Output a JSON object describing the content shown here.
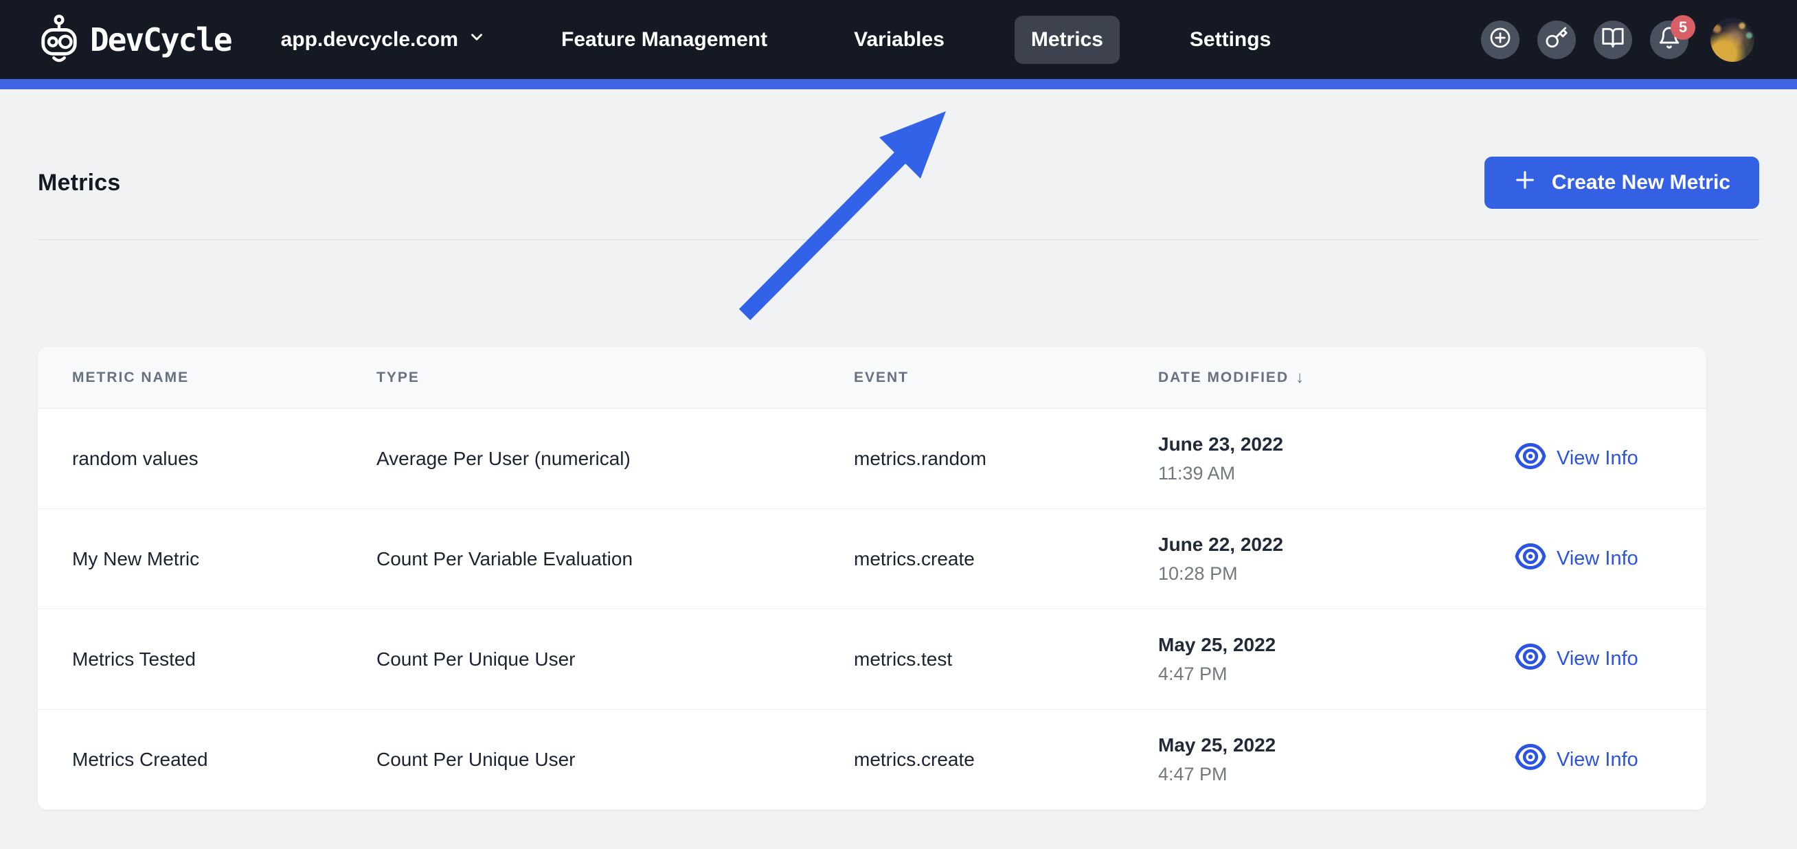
{
  "navbar": {
    "brand": "DevCycle",
    "org_label": "app.devcycle.com",
    "links": [
      {
        "label": "Feature Management",
        "active": false
      },
      {
        "label": "Variables",
        "active": false
      },
      {
        "label": "Metrics",
        "active": true
      },
      {
        "label": "Settings",
        "active": false
      }
    ],
    "notification_count": "5"
  },
  "page": {
    "title": "Metrics",
    "create_button_label": "Create New Metric"
  },
  "table": {
    "columns": [
      "Metric Name",
      "Type",
      "Event",
      "Date Modified"
    ],
    "sort_column": "Date Modified",
    "sort_glyph": "↓",
    "action_label": "View Info",
    "rows": [
      {
        "name": "random values",
        "type": "Average Per User (numerical)",
        "event": "metrics.random",
        "date": "June 23, 2022",
        "time": "11:39 AM"
      },
      {
        "name": "My New Metric",
        "type": "Count Per Variable Evaluation",
        "event": "metrics.create",
        "date": "June 22, 2022",
        "time": "10:28 PM"
      },
      {
        "name": "Metrics Tested",
        "type": "Count Per Unique User",
        "event": "metrics.test",
        "date": "May 25, 2022",
        "time": "4:47 PM"
      },
      {
        "name": "Metrics Created",
        "type": "Count Per Unique User",
        "event": "metrics.create",
        "date": "May 25, 2022",
        "time": "4:47 PM"
      }
    ]
  },
  "colors": {
    "navbar_bg": "#151923",
    "active_tab_bg": "#3c434f",
    "accent_strip": "#4264e4",
    "button_blue": "#3461e3",
    "link_blue": "#2b53e4",
    "arrow_blue": "#3162e7",
    "badge_red": "#d85f66",
    "page_bg": "#f1f2f4"
  }
}
